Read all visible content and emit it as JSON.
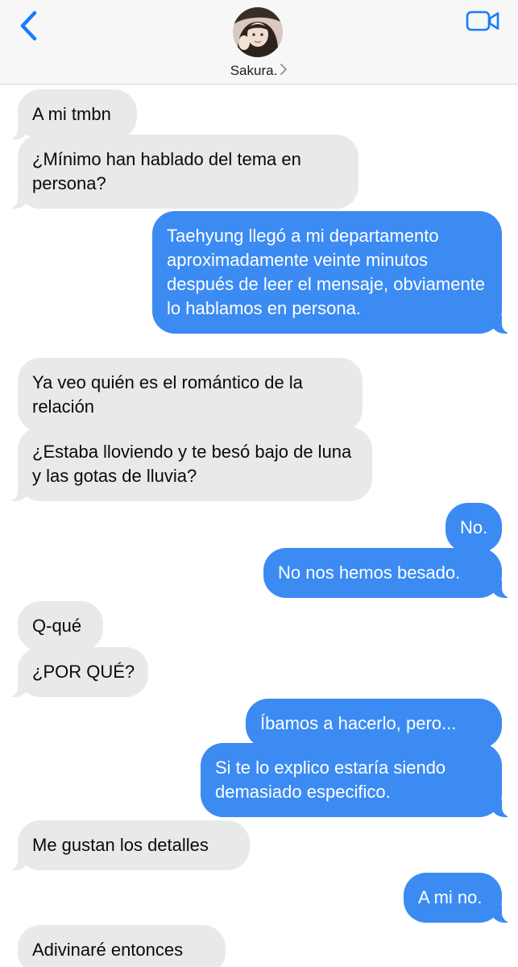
{
  "header": {
    "contact_name": "Sakura.",
    "back_icon": "chevron-left-icon",
    "video_icon": "video-camera-icon",
    "accent": "#147efb"
  },
  "colors": {
    "incoming_bubble": "#e9e9eb",
    "outgoing_bubble": "#3b8bf3"
  },
  "messages": [
    {
      "side": "in",
      "text": "A mi tmbn"
    },
    {
      "side": "in",
      "text": "¿Mínimo han hablado del tema en persona?"
    },
    {
      "side": "out",
      "text": "Taehyung llegó a mi departamento aproximadamente veinte minutos después de leer el mensaje, obviamente lo hablamos en persona."
    },
    {
      "side": "in",
      "text": "Ya veo quién es el romántico de la relación"
    },
    {
      "side": "in",
      "text": "¿Estaba lloviendo y te besó bajo de luna y las gotas de lluvia?"
    },
    {
      "side": "out",
      "text": "No."
    },
    {
      "side": "out",
      "text": "No nos hemos besado."
    },
    {
      "side": "in",
      "text": "Q-qué"
    },
    {
      "side": "in",
      "text": "¿POR QUÉ?"
    },
    {
      "side": "out",
      "text": "Íbamos a hacerlo, pero..."
    },
    {
      "side": "out",
      "text": "Si te lo explico estaría siendo demasiado especifico."
    },
    {
      "side": "in",
      "text": "Me gustan los detalles"
    },
    {
      "side": "out",
      "text": "A mi no."
    },
    {
      "side": "in",
      "text": "Adivinaré entonces"
    }
  ]
}
